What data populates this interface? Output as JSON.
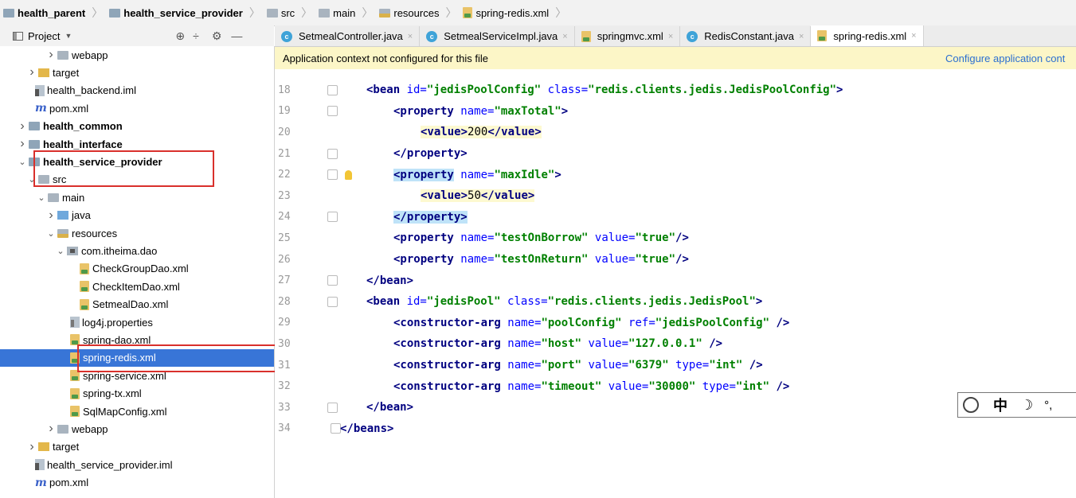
{
  "breadcrumb": [
    "health_parent",
    "health_service_provider",
    "src",
    "main",
    "resources",
    "spring-redis.xml"
  ],
  "project_panel": {
    "title": "Project",
    "tree": [
      {
        "label": "webapp",
        "indent": 4,
        "arrow": ">",
        "icon": "folder-webapp-icon"
      },
      {
        "label": "target",
        "indent": 2,
        "arrow": ">",
        "icon": "folder-target-icon"
      },
      {
        "label": "health_backend.iml",
        "indent": 3,
        "arrow": "",
        "icon": "iml-file-icon"
      },
      {
        "label": "pom.xml",
        "indent": 3,
        "arrow": "",
        "icon": "maven-pom-icon"
      },
      {
        "label": "health_common",
        "indent": 1,
        "arrow": ">",
        "icon": "module-folder-icon",
        "bold": true
      },
      {
        "label": "health_interface",
        "indent": 1,
        "arrow": ">",
        "icon": "module-folder-icon",
        "bold": true
      },
      {
        "label": "health_service_provider",
        "indent": 1,
        "arrow": "v",
        "icon": "module-folder-icon",
        "bold": true
      },
      {
        "label": "src",
        "indent": 2,
        "arrow": "v",
        "icon": "folder-icon"
      },
      {
        "label": "main",
        "indent": 3,
        "arrow": "v",
        "icon": "folder-icon"
      },
      {
        "label": "java",
        "indent": 4,
        "arrow": ">",
        "icon": "java-source-folder-icon"
      },
      {
        "label": "resources",
        "indent": 4,
        "arrow": "v",
        "icon": "resources-folder-icon"
      },
      {
        "label": "com.itheima.dao",
        "indent": 5,
        "arrow": "v",
        "icon": "package-icon"
      },
      {
        "label": "CheckGroupDao.xml",
        "indent": 7,
        "arrow": "",
        "icon": "xml-file-icon"
      },
      {
        "label": "CheckItemDao.xml",
        "indent": 7,
        "arrow": "",
        "icon": "xml-file-icon"
      },
      {
        "label": "SetmealDao.xml",
        "indent": 7,
        "arrow": "",
        "icon": "xml-file-icon"
      },
      {
        "label": "log4j.properties",
        "indent": 6,
        "arrow": "",
        "icon": "properties-file-icon"
      },
      {
        "label": "spring-dao.xml",
        "indent": 6,
        "arrow": "",
        "icon": "spring-xml-icon"
      },
      {
        "label": "spring-redis.xml",
        "indent": 6,
        "arrow": "",
        "icon": "spring-xml-icon",
        "selected": true
      },
      {
        "label": "spring-service.xml",
        "indent": 6,
        "arrow": "",
        "icon": "spring-xml-icon"
      },
      {
        "label": "spring-tx.xml",
        "indent": 6,
        "arrow": "",
        "icon": "spring-xml-icon"
      },
      {
        "label": "SqlMapConfig.xml",
        "indent": 6,
        "arrow": "",
        "icon": "xml-file-icon"
      },
      {
        "label": "webapp",
        "indent": 4,
        "arrow": ">",
        "icon": "folder-webapp-icon"
      },
      {
        "label": "target",
        "indent": 2,
        "arrow": ">",
        "icon": "folder-target-icon"
      },
      {
        "label": "health_service_provider.iml",
        "indent": 3,
        "arrow": "",
        "icon": "iml-file-icon"
      },
      {
        "label": "pom.xml",
        "indent": 3,
        "arrow": "",
        "icon": "maven-pom-icon"
      }
    ]
  },
  "tabs": [
    {
      "label": "SetmealController.java",
      "icon": "class-icon",
      "active": false
    },
    {
      "label": "SetmealServiceImpl.java",
      "icon": "class-icon",
      "active": false
    },
    {
      "label": "springmvc.xml",
      "icon": "spring-xml-icon",
      "active": false
    },
    {
      "label": "RedisConstant.java",
      "icon": "class-icon",
      "active": false
    },
    {
      "label": "spring-redis.xml",
      "icon": "spring-xml-icon",
      "active": true
    }
  ],
  "notice": {
    "message": "Application context not configured for this file",
    "link": "Configure application cont"
  },
  "code": [
    {
      "n": "18",
      "indent": 0,
      "tokens": [
        [
          "tag",
          "<bean "
        ],
        [
          "attr",
          "id="
        ],
        [
          "val",
          "\"jedisPoolConfig\" "
        ],
        [
          "attr",
          "class="
        ],
        [
          "val",
          "\"redis.clients.jedis.JedisPoolConfig\""
        ],
        [
          "tag",
          ">"
        ]
      ]
    },
    {
      "n": "19",
      "indent": 1,
      "tokens": [
        [
          "tag",
          "<property "
        ],
        [
          "attr",
          "name="
        ],
        [
          "val",
          "\"maxTotal\""
        ],
        [
          "tag",
          ">"
        ]
      ]
    },
    {
      "n": "20",
      "indent": 2,
      "hl": "val",
      "tokens": [
        [
          "tag",
          "<value>"
        ],
        [
          "plain",
          "200"
        ],
        [
          "tag",
          "</value>"
        ]
      ]
    },
    {
      "n": "21",
      "indent": 1,
      "tokens": [
        [
          "tag",
          "</property>"
        ]
      ]
    },
    {
      "n": "22",
      "indent": 1,
      "bulb": true,
      "tokens": [
        [
          "hltag",
          "<property"
        ],
        [
          "plain",
          " "
        ],
        [
          "attr",
          "name="
        ],
        [
          "val",
          "\"maxIdle\""
        ],
        [
          "tag",
          ">"
        ]
      ]
    },
    {
      "n": "23",
      "indent": 2,
      "hl": "val",
      "tokens": [
        [
          "tag",
          "<value>"
        ],
        [
          "plain",
          "50"
        ],
        [
          "tag",
          "</value>"
        ]
      ]
    },
    {
      "n": "24",
      "indent": 1,
      "tokens": [
        [
          "hltag",
          "</property>"
        ]
      ]
    },
    {
      "n": "25",
      "indent": 1,
      "tokens": [
        [
          "tag",
          "<property "
        ],
        [
          "attr",
          "name="
        ],
        [
          "val",
          "\"testOnBorrow\" "
        ],
        [
          "attr",
          "value="
        ],
        [
          "val",
          "\"true\""
        ],
        [
          "tag",
          "/>"
        ]
      ]
    },
    {
      "n": "26",
      "indent": 1,
      "tokens": [
        [
          "tag",
          "<property "
        ],
        [
          "attr",
          "name="
        ],
        [
          "val",
          "\"testOnReturn\" "
        ],
        [
          "attr",
          "value="
        ],
        [
          "val",
          "\"true\""
        ],
        [
          "tag",
          "/>"
        ]
      ]
    },
    {
      "n": "27",
      "indent": 0,
      "tokens": [
        [
          "tag",
          "</bean>"
        ]
      ]
    },
    {
      "n": "28",
      "indent": 0,
      "tokens": [
        [
          "tag",
          "<bean "
        ],
        [
          "attr",
          "id="
        ],
        [
          "val",
          "\"jedisPool\" "
        ],
        [
          "attr",
          "class="
        ],
        [
          "val",
          "\"redis.clients.jedis.JedisPool\""
        ],
        [
          "tag",
          ">"
        ]
      ]
    },
    {
      "n": "29",
      "indent": 1,
      "tokens": [
        [
          "tag",
          "<constructor-arg "
        ],
        [
          "attr",
          "name="
        ],
        [
          "val",
          "\"poolConfig\" "
        ],
        [
          "attr",
          "ref="
        ],
        [
          "val",
          "\"jedisPoolConfig\" "
        ],
        [
          "tag",
          "/>"
        ]
      ]
    },
    {
      "n": "30",
      "indent": 1,
      "tokens": [
        [
          "tag",
          "<constructor-arg "
        ],
        [
          "attr",
          "name="
        ],
        [
          "val",
          "\"host\" "
        ],
        [
          "attr",
          "value="
        ],
        [
          "val",
          "\"127.0.0.1\" "
        ],
        [
          "tag",
          "/>"
        ]
      ]
    },
    {
      "n": "31",
      "indent": 1,
      "tokens": [
        [
          "tag",
          "<constructor-arg "
        ],
        [
          "attr",
          "name="
        ],
        [
          "val",
          "\"port\" "
        ],
        [
          "attr",
          "value="
        ],
        [
          "val",
          "\"6379\" "
        ],
        [
          "attr",
          "type="
        ],
        [
          "val",
          "\"int\" "
        ],
        [
          "tag",
          "/>"
        ]
      ]
    },
    {
      "n": "32",
      "indent": 1,
      "tokens": [
        [
          "tag",
          "<constructor-arg "
        ],
        [
          "attr",
          "name="
        ],
        [
          "val",
          "\"timeout\" "
        ],
        [
          "attr",
          "value="
        ],
        [
          "val",
          "\"30000\" "
        ],
        [
          "attr",
          "type="
        ],
        [
          "val",
          "\"int\" "
        ],
        [
          "tag",
          "/>"
        ]
      ]
    },
    {
      "n": "33",
      "indent": 0,
      "tokens": [
        [
          "tag",
          "</bean>"
        ]
      ]
    },
    {
      "n": "34",
      "indent": -1,
      "tokens": [
        [
          "tag",
          "</beans>"
        ]
      ]
    }
  ],
  "ime": {
    "mode": "中",
    "moon": "☽",
    "punct": "°,"
  },
  "colors": {
    "selection": "#3875d7",
    "notice_bg": "#fcf6c7",
    "annotation_box": "#d9302c",
    "xml_tag": "#000080",
    "xml_attr": "#0000ff",
    "xml_value": "#008000"
  }
}
